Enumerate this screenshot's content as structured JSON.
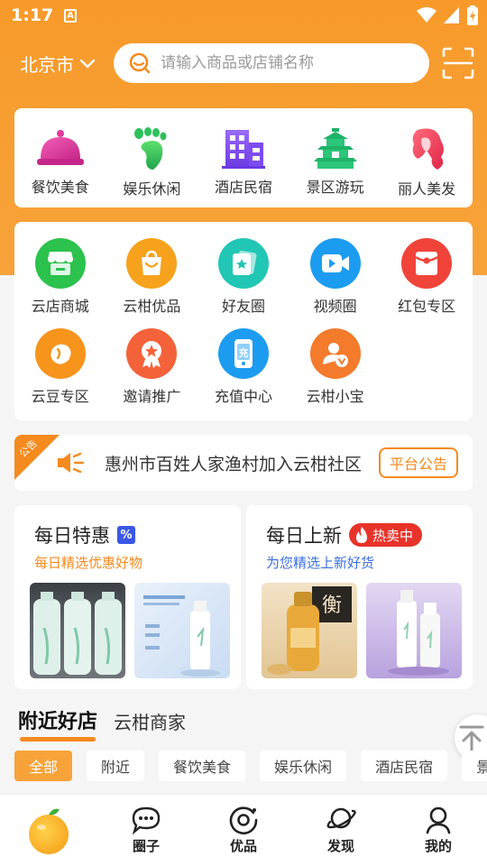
{
  "status_bar": {
    "time": "1:17",
    "a_label": "A"
  },
  "header": {
    "city": "北京市",
    "search_placeholder": "请输入商品或店铺名称"
  },
  "categories": [
    {
      "label": "餐饮美食",
      "icon": "cloche-icon"
    },
    {
      "label": "娱乐休闲",
      "icon": "footprint-icon"
    },
    {
      "label": "酒店民宿",
      "icon": "hotel-building-icon"
    },
    {
      "label": "景区游玩",
      "icon": "pagoda-icon"
    },
    {
      "label": "丽人美发",
      "icon": "hair-icon"
    }
  ],
  "services": [
    {
      "label": "云店商城",
      "icon": "store-icon",
      "color": "#2bc24d"
    },
    {
      "label": "云柑优品",
      "icon": "shopping-bag-icon",
      "color": "#f7a21c"
    },
    {
      "label": "好友圈",
      "icon": "cards-star-icon",
      "color": "#22c6b4"
    },
    {
      "label": "视频圈",
      "icon": "video-icon",
      "color": "#1c9cf0"
    },
    {
      "label": "红包专区",
      "icon": "red-packet-icon",
      "color": "#f0443a"
    },
    {
      "label": "云豆专区",
      "icon": "bean-icon",
      "color": "#f7941c"
    },
    {
      "label": "邀请推广",
      "icon": "award-icon",
      "color": "#f4623a"
    },
    {
      "label": "充值中心",
      "icon": "recharge-phone-icon",
      "color": "#1c9cf0"
    },
    {
      "label": "云柑小宝",
      "icon": "assistant-user-icon",
      "color": "#f47a2c"
    }
  ],
  "notice": {
    "ribbon": "公告",
    "text": "惠州市百姓人家渔村加入云柑社区",
    "button": "平台公告"
  },
  "promos": {
    "daily_deal": {
      "title": "每日特惠",
      "badge": "%",
      "subtitle": "每日精选优惠好物",
      "subtitle_color": "#f58a1f"
    },
    "daily_new": {
      "title": "每日上新",
      "badge": "热卖中",
      "subtitle": "为您精选上新好货",
      "subtitle_color": "#3b6fe0"
    }
  },
  "tabs": [
    {
      "label": "附近好店",
      "active": true
    },
    {
      "label": "云柑商家",
      "active": false
    }
  ],
  "chips": [
    {
      "label": "全部",
      "active": true
    },
    {
      "label": "附近"
    },
    {
      "label": "餐饮美食"
    },
    {
      "label": "娱乐休闲"
    },
    {
      "label": "酒店民宿"
    },
    {
      "label": "景"
    }
  ],
  "bottom_nav": [
    {
      "label": "",
      "icon": "orange-fruit-icon",
      "active": true
    },
    {
      "label": "圈子",
      "icon": "chat-bubble-icon"
    },
    {
      "label": "优品",
      "icon": "target-icon"
    },
    {
      "label": "发现",
      "icon": "planet-icon"
    },
    {
      "label": "我的",
      "icon": "user-icon"
    }
  ]
}
